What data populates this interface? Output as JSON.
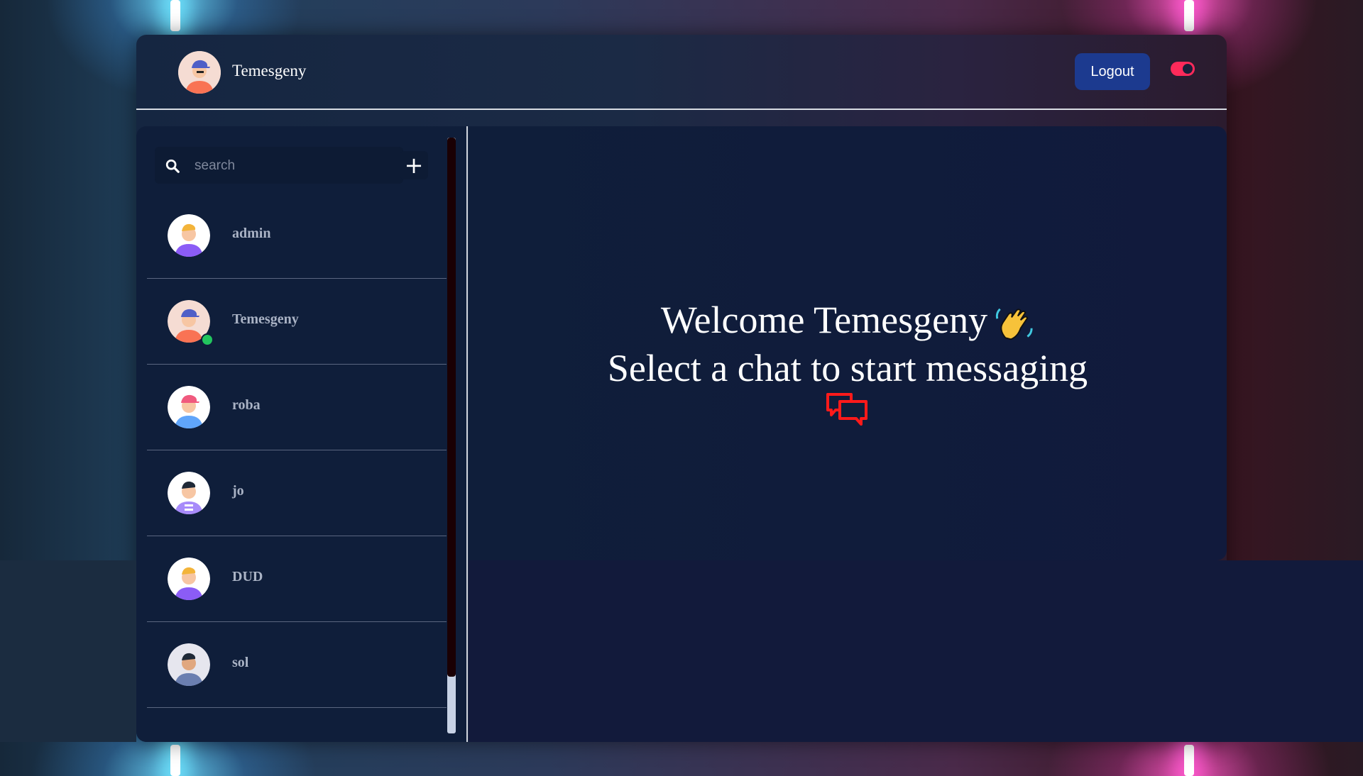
{
  "header": {
    "username": "Temesgeny",
    "logout_label": "Logout",
    "avatar_icon": "user-avatar-icon",
    "theme_toggle_icon": "theme-toggle-icon"
  },
  "sidebar": {
    "search": {
      "placeholder": "search",
      "value": ""
    },
    "add_label": "+",
    "users": [
      {
        "name": "admin",
        "online": false,
        "avatar_color": "#8b5cf6"
      },
      {
        "name": "Temesgeny",
        "online": true,
        "avatar_color": "#f97354"
      },
      {
        "name": "roba",
        "online": false,
        "avatar_color": "#60a5fa"
      },
      {
        "name": "jo",
        "online": false,
        "avatar_color": "#a78bfa"
      },
      {
        "name": "DUD",
        "online": false,
        "avatar_color": "#8b5cf6"
      },
      {
        "name": "sol",
        "online": false,
        "avatar_color": "#6b7fb0"
      }
    ]
  },
  "main": {
    "welcome_line1": "Welcome Temesgeny",
    "welcome_line2": "Select a chat to start messaging",
    "wave_icon": "waving-hand-icon",
    "chat_icon": "chat-bubbles-icon"
  },
  "colors": {
    "accent": "#1c3a8f",
    "toggle": "#ff2a5a",
    "online": "#22c55e",
    "chat_icon": "#ff1a1a"
  }
}
